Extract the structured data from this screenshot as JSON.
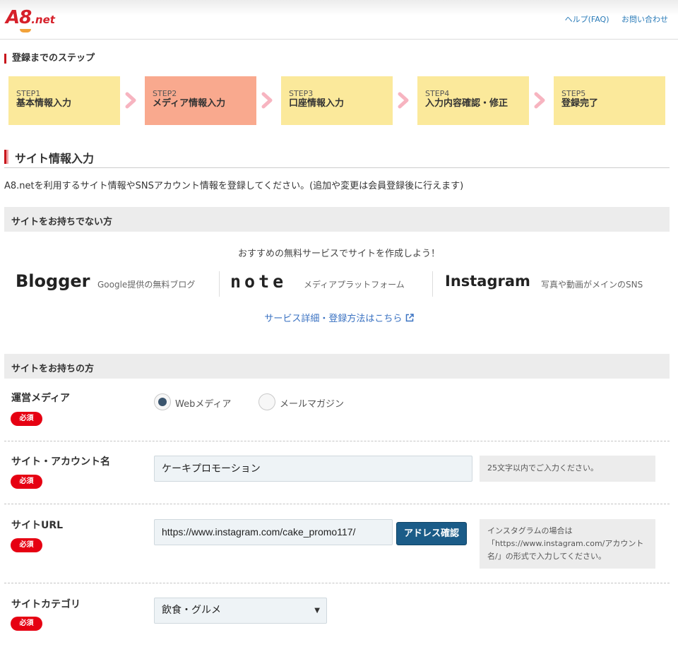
{
  "header": {
    "logo": {
      "main": "A8",
      "suffix": ".net"
    },
    "links": [
      "ヘルプ(FAQ)",
      "お問い合わせ"
    ]
  },
  "steps_section": {
    "label": "登録までのステップ",
    "steps": [
      {
        "num": "STEP1",
        "name": "基本情報入力",
        "active": false
      },
      {
        "num": "STEP2",
        "name": "メディア情報入力",
        "active": true
      },
      {
        "num": "STEP3",
        "name": "口座情報入力",
        "active": false
      },
      {
        "num": "STEP4",
        "name": "入力内容確認・修正",
        "active": false
      },
      {
        "num": "STEP5",
        "name": "登録完了",
        "active": false
      }
    ]
  },
  "page_title": "サイト情報入力",
  "intro": "A8.netを利用するサイト情報やSNSアカウント情報を登録してください。(追加や変更は会員登録後に行えます)",
  "no_site": {
    "heading": "サイトをお持ちでない方",
    "recommend": "おすすめの無料サービスでサイトを作成しよう！",
    "services": [
      {
        "name": "Blogger",
        "desc": "Google提供の無料ブログ"
      },
      {
        "name": "note",
        "desc": "メディアプラットフォーム"
      },
      {
        "name": "Instagram",
        "desc": "写真や動画がメインのSNS"
      }
    ],
    "link": "サービス詳細・登録方法はこちら"
  },
  "has_site": {
    "heading": "サイトをお持ちの方",
    "required_label": "必須",
    "media": {
      "label": "運営メディア",
      "options": [
        {
          "label": "Webメディア",
          "selected": true
        },
        {
          "label": "メールマガジン",
          "selected": false
        }
      ]
    },
    "account_name": {
      "label": "サイト・アカウント名",
      "value": "ケーキプロモーション",
      "hint": "25文字以内でご入力ください。"
    },
    "url": {
      "label": "サイトURL",
      "value": "https://www.instagram.com/cake_promo117/",
      "button": "アドレス確認",
      "hint": "インスタグラムの場合は「https://www.instagram.com/アカウント名/」の形式で入力してください。"
    },
    "category": {
      "label": "サイトカテゴリ",
      "value": "飲食・グルメ"
    }
  },
  "colors": {
    "brand_red": "#d6202a",
    "step_inactive": "#fbe99b",
    "step_active": "#f9a98e",
    "arrow_pink": "#f7b4c0",
    "link_blue": "#3a72c2",
    "button_blue": "#1b5c88",
    "required_red": "#e60012"
  }
}
